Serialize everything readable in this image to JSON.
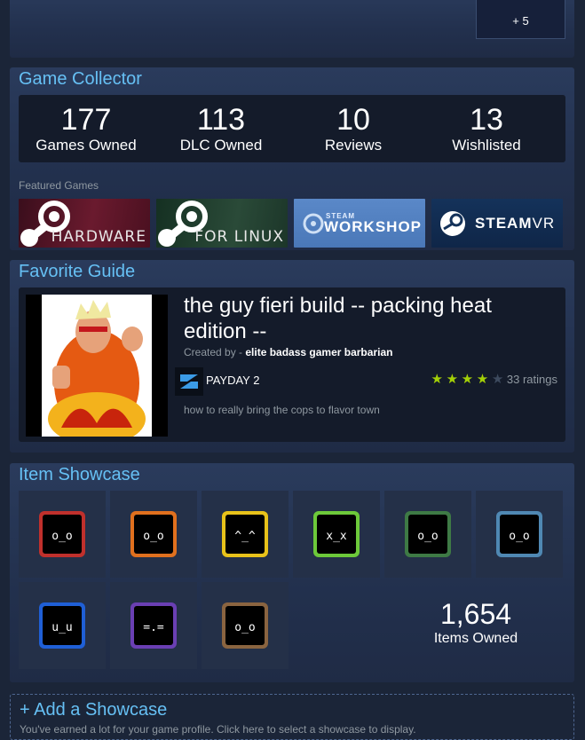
{
  "top_panel": {
    "more_label": "+ 5"
  },
  "game_collector": {
    "title": "Game Collector",
    "stats": [
      {
        "value": "177",
        "label": "Games Owned"
      },
      {
        "value": "113",
        "label": "DLC Owned"
      },
      {
        "value": "10",
        "label": "Reviews"
      },
      {
        "value": "13",
        "label": "Wishlisted"
      }
    ],
    "featured_label": "Featured Games",
    "featured": [
      {
        "caption": "HARDWARE"
      },
      {
        "caption": "FOR LINUX"
      },
      {
        "caption": "WORKSHOP",
        "top": "STEAM"
      },
      {
        "caption": "STEAM",
        "suffix": "VR"
      }
    ]
  },
  "favorite_guide": {
    "title": "Favorite Guide",
    "guide_title": "the guy fieri build -- packing heat edition --",
    "created_by_prefix": "Created by - ",
    "author": "elite badass gamer barbarian",
    "game": "PAYDAY 2",
    "ratings_text": "33 ratings",
    "stars": 4,
    "description": "how to really bring the cops to flavor town"
  },
  "item_showcase": {
    "title": "Item Showcase",
    "items": [
      {
        "color": "#c0302c",
        "face": "o_o"
      },
      {
        "color": "#e0701e",
        "face": "o_o"
      },
      {
        "color": "#e8c21a",
        "face": "^_^"
      },
      {
        "color": "#6dc93a",
        "face": "x_x"
      },
      {
        "color": "#3e7a45",
        "face": "o_o"
      },
      {
        "color": "#4f88b3",
        "face": "o_o"
      },
      {
        "color": "#1f5fd6",
        "face": "u_u"
      },
      {
        "color": "#6a3fb3",
        "face": "=.="
      },
      {
        "color": "#8a6440",
        "face": "o_o"
      }
    ],
    "items_owned_value": "1,654",
    "items_owned_label": "Items Owned"
  },
  "add_showcase": {
    "label": "+ Add a Showcase",
    "hint": "You've earned a lot for your game profile. Click here to select a showcase to display."
  }
}
